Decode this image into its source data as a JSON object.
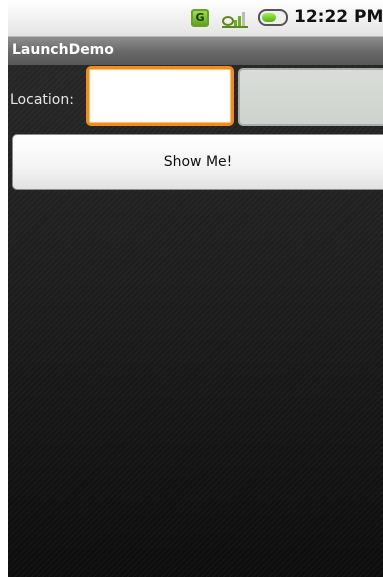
{
  "status_bar": {
    "g_icon_label": "G",
    "clock": "12:22 PM",
    "icons": [
      "g-network-icon",
      "signal-icon",
      "battery-icon"
    ]
  },
  "app": {
    "title": "LaunchDemo"
  },
  "form": {
    "location_label": "Location:",
    "location_value": "",
    "second_field_value": "",
    "show_button_label": "Show Me!"
  },
  "colors": {
    "focus_accent": "#f28b1c",
    "title_bar": "#6a6a6a",
    "background": "#1c1c1c"
  }
}
